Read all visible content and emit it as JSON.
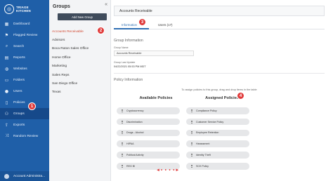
{
  "brand": {
    "line1": "TRIAGE",
    "line2": "KITCHEN"
  },
  "sidebar": {
    "items": [
      {
        "label": "Dashboard",
        "icon": "dashboard-icon",
        "glyph": "▦"
      },
      {
        "label": "Flagged Review",
        "icon": "flag-icon",
        "glyph": "⚑"
      },
      {
        "label": "Search",
        "icon": "search-icon",
        "glyph": "⌕"
      },
      {
        "label": "Reports",
        "icon": "chart-icon",
        "glyph": "▤"
      },
      {
        "label": "Websites",
        "icon": "globe-icon",
        "glyph": "◍"
      },
      {
        "label": "Folders",
        "icon": "folder-icon",
        "glyph": "▭"
      },
      {
        "label": "Users",
        "icon": "users-icon",
        "glyph": "●"
      },
      {
        "label": "Policies",
        "icon": "document-icon",
        "glyph": "▯"
      },
      {
        "label": "Groups",
        "icon": "groups-icon",
        "glyph": "⚇"
      },
      {
        "label": "Exports",
        "icon": "export-icon",
        "glyph": "⇪"
      },
      {
        "label": "Random Review",
        "icon": "shuffle-icon",
        "glyph": "⤨"
      }
    ],
    "footer": "Account Administra..."
  },
  "groups_panel": {
    "title": "Groups",
    "collapse": "«",
    "add_button": "Add New Group",
    "items": [
      "Accounts Receivable",
      "Advisors",
      "Boca Raton Sales Office",
      "Home Office",
      "Marketing",
      "Sales Reps",
      "San Diego Office",
      "Texas"
    ]
  },
  "main": {
    "header": "Accounts Receivable",
    "tabs": {
      "information": "Information",
      "users": "Users (17)"
    },
    "group_info": {
      "title": "Group Information",
      "name_label": "Group Name",
      "name_value": "Accounts Receivable",
      "updated_label": "Group Last Update",
      "updated_value": "04/22/2021 05:53 PM MDT"
    },
    "policy_info": {
      "title": "Policy Information",
      "hint": "To assign policies to this group, drag and drop items in the table",
      "available_title": "Available Policies",
      "assigned_title": "Assigned Policies",
      "available": [
        "Cryptocurrency",
        "Discrimination",
        "Drugs - Alcohol",
        "HIPAA",
        "Political Activity",
        "REG BI"
      ],
      "assigned": [
        "Compliance Policy",
        "Customer Service Policy",
        "Employee Retention",
        "Harassment",
        "Identity Theft",
        "SCK Policy"
      ]
    }
  },
  "callouts": {
    "one": "1",
    "two": "2",
    "three": "3",
    "four": "4",
    "arrow": "◄• • • •►"
  },
  "colors": {
    "sidebar": "#1f5fa8",
    "accent": "#2f6fb3",
    "callout": "#e03a3a",
    "selected_group": "#d24a32"
  }
}
